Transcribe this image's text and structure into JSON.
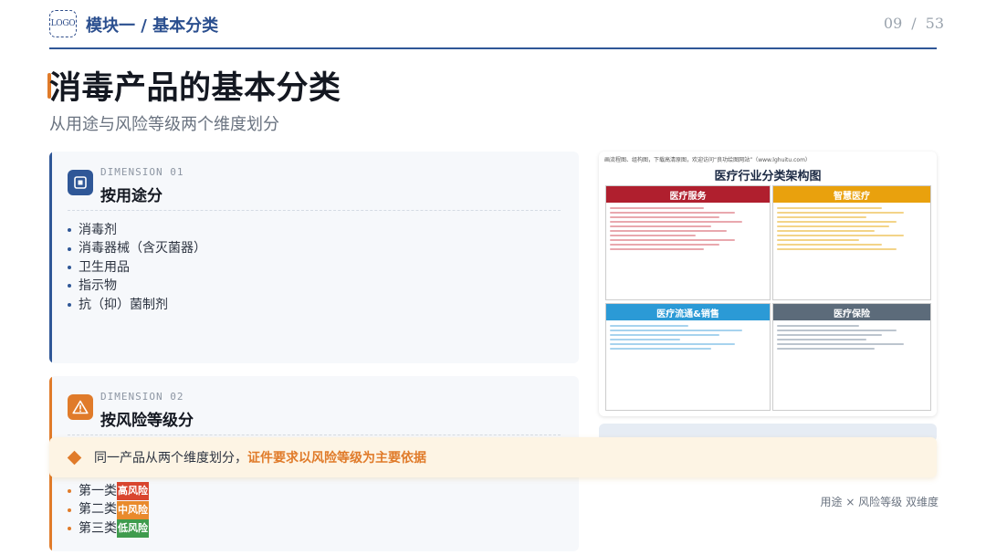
{
  "header": {
    "logo": "LOGO",
    "module": "模块一 / 基本分类",
    "page_current": "09",
    "page_sep": "/",
    "page_total": "53"
  },
  "title": "消毒产品的基本分类",
  "subtitle": "从用途与风险等级两个维度划分",
  "card_usage": {
    "dimension": "DIMENSION 01",
    "title": "按用途分",
    "icon": "square-target-icon",
    "items": [
      "消毒剂",
      "消毒器械（含灭菌器）",
      "卫生用品",
      "指示物",
      "抗（抑）菌制剂"
    ]
  },
  "card_risk": {
    "dimension": "DIMENSION 02",
    "title": "按风险等级分",
    "icon": "warning-triangle-icon",
    "items": [
      {
        "label": "第一类",
        "tag": "高风险"
      },
      {
        "label": "第二类",
        "tag": "中风险"
      },
      {
        "label": "第三类",
        "tag": "低风险"
      }
    ]
  },
  "banner": {
    "text": "同一产品从两个维度划分，",
    "emphasis": "证件要求以风险等级为主要依据"
  },
  "figure": {
    "note": "画流程图、组构图，下载高清原图，欢迎访问“良功绘图网站”（www.lghuitu.com）",
    "title": "医疗行业分类架构图",
    "panels": [
      "医疗服务",
      "智慧医疗",
      "医疗流通&销售",
      "医疗保险"
    ]
  },
  "caption": "用途 × 风险等级 双维度",
  "colors": {
    "primary": "#2f5797",
    "accent": "#e07b2a",
    "high": "#d9452f",
    "mid": "#e98a2c",
    "low": "#3f9b4d"
  }
}
